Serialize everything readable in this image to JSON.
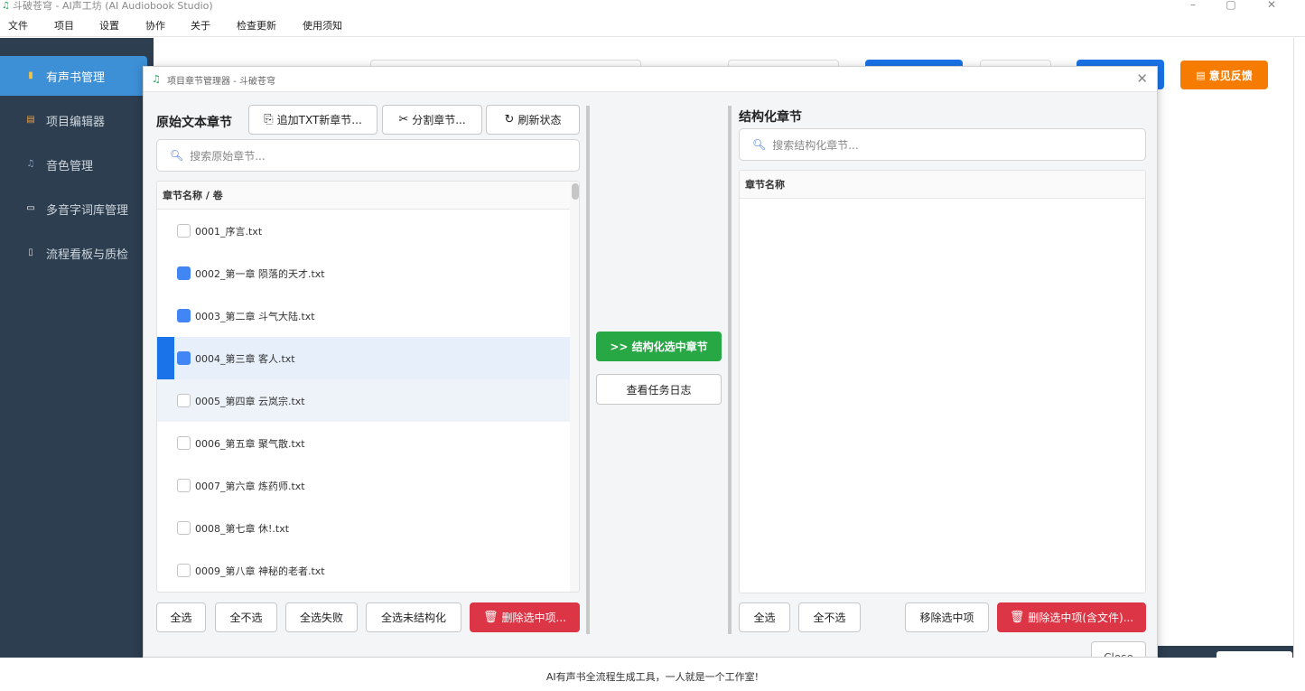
{
  "window": {
    "title": "斗破苍穹 - AI声工坊 (AI Audiobook Studio)",
    "controls": [
      "–",
      "▢",
      "✕"
    ]
  },
  "menu": [
    "文件",
    "项目",
    "设置",
    "协作",
    "关于",
    "检查更新",
    "使用须知"
  ],
  "sidebar": {
    "items": [
      {
        "label": "有声书管理",
        "icon": "books-icon",
        "active": true
      },
      {
        "label": "项目编辑器",
        "icon": "document-edit-icon",
        "active": false
      },
      {
        "label": "音色管理",
        "icon": "music-note-icon",
        "active": false
      },
      {
        "label": "多音字词库管理",
        "icon": "open-book-icon",
        "active": false
      },
      {
        "label": "流程看板与质检",
        "icon": "clipboard-icon",
        "active": false
      }
    ]
  },
  "main": {
    "feedback_label": "意见反馈"
  },
  "dialog": {
    "title": "项目章节管理器 - 斗破苍穹",
    "left": {
      "title": "原始文本章节",
      "add_txt_label": "追加TXT新章节...",
      "split_label": "分割章节...",
      "refresh_label": "刷新状态",
      "search_placeholder": "搜索原始章节...",
      "column_header": "章节名称 / 卷",
      "rows": [
        {
          "name": "0001_序言.txt",
          "checked": false
        },
        {
          "name": "0002_第一章 陨落的天才.txt",
          "checked": true
        },
        {
          "name": "0003_第二章 斗气大陆.txt",
          "checked": true
        },
        {
          "name": "0004_第三章 客人.txt",
          "checked": true
        },
        {
          "name": "0005_第四章 云岚宗.txt",
          "checked": false
        },
        {
          "name": "0006_第五章 聚气散.txt",
          "checked": false
        },
        {
          "name": "0007_第六章 炼药师.txt",
          "checked": false
        },
        {
          "name": "0008_第七章 休!.txt",
          "checked": false
        },
        {
          "name": "0009_第八章 神秘的老者.txt",
          "checked": false
        }
      ],
      "select_all": "全选",
      "select_none": "全不选",
      "select_failed": "全选失败",
      "select_unstructured": "全选未结构化",
      "delete_selected": "删除选中项..."
    },
    "middle": {
      "structure_label": ">> 结构化选中章节",
      "log_label": "查看任务日志"
    },
    "right": {
      "title": "结构化章节",
      "search_placeholder": "搜索结构化章节...",
      "column_header": "章节名称",
      "select_all": "全选",
      "select_none": "全不选",
      "remove_selected": "移除选中项",
      "delete_with_files": "删除选中项(含文件)..."
    },
    "close_label": "Close"
  },
  "footer": "AI有声书全流程生成工具，一人就是一个工作室!"
}
